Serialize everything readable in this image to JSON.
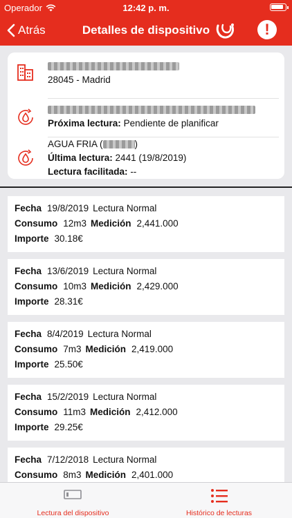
{
  "status_bar": {
    "carrier": "Operador",
    "time": "12:42 p. m."
  },
  "nav": {
    "back_label": "Atrás",
    "title": "Detalles de dispositivo",
    "alert_label": "!"
  },
  "device": {
    "address_line2": "28045 - Madrid",
    "next_reading_label": "Próxima lectura:",
    "next_reading_value": "Pendiente de planificar",
    "water_type": "AGUA FRIA (",
    "water_type_close": ")",
    "last_reading_label": "Última lectura:",
    "last_reading_value": "2441 (19/8/2019)",
    "provided_reading_label": "Lectura facilitada:",
    "provided_reading_value": "--"
  },
  "labels": {
    "fecha": "Fecha",
    "consumo": "Consumo",
    "medicion": "Medición",
    "importe": "Importe"
  },
  "readings": [
    {
      "fecha": "19/8/2019",
      "tipo": "Lectura Normal",
      "consumo": "12m3",
      "medicion": "2,441.000",
      "importe": "30.18€"
    },
    {
      "fecha": "13/6/2019",
      "tipo": "Lectura Normal",
      "consumo": "10m3",
      "medicion": "2,429.000",
      "importe": "28.31€"
    },
    {
      "fecha": "8/4/2019",
      "tipo": "Lectura Normal",
      "consumo": "7m3",
      "medicion": "2,419.000",
      "importe": "25.50€"
    },
    {
      "fecha": "15/2/2019",
      "tipo": "Lectura Normal",
      "consumo": "11m3",
      "medicion": "2,412.000",
      "importe": "29.25€"
    },
    {
      "fecha": "7/12/2018",
      "tipo": "Lectura Normal",
      "consumo": "8m3",
      "medicion": "2,401.000",
      "importe": ""
    }
  ],
  "tabs": [
    {
      "label": "Lectura del dispositivo",
      "icon": "meter-icon"
    },
    {
      "label": "Histórico de lecturas",
      "icon": "list-icon"
    }
  ],
  "colors": {
    "accent": "#e52d1e",
    "background": "#e9e9ec"
  }
}
